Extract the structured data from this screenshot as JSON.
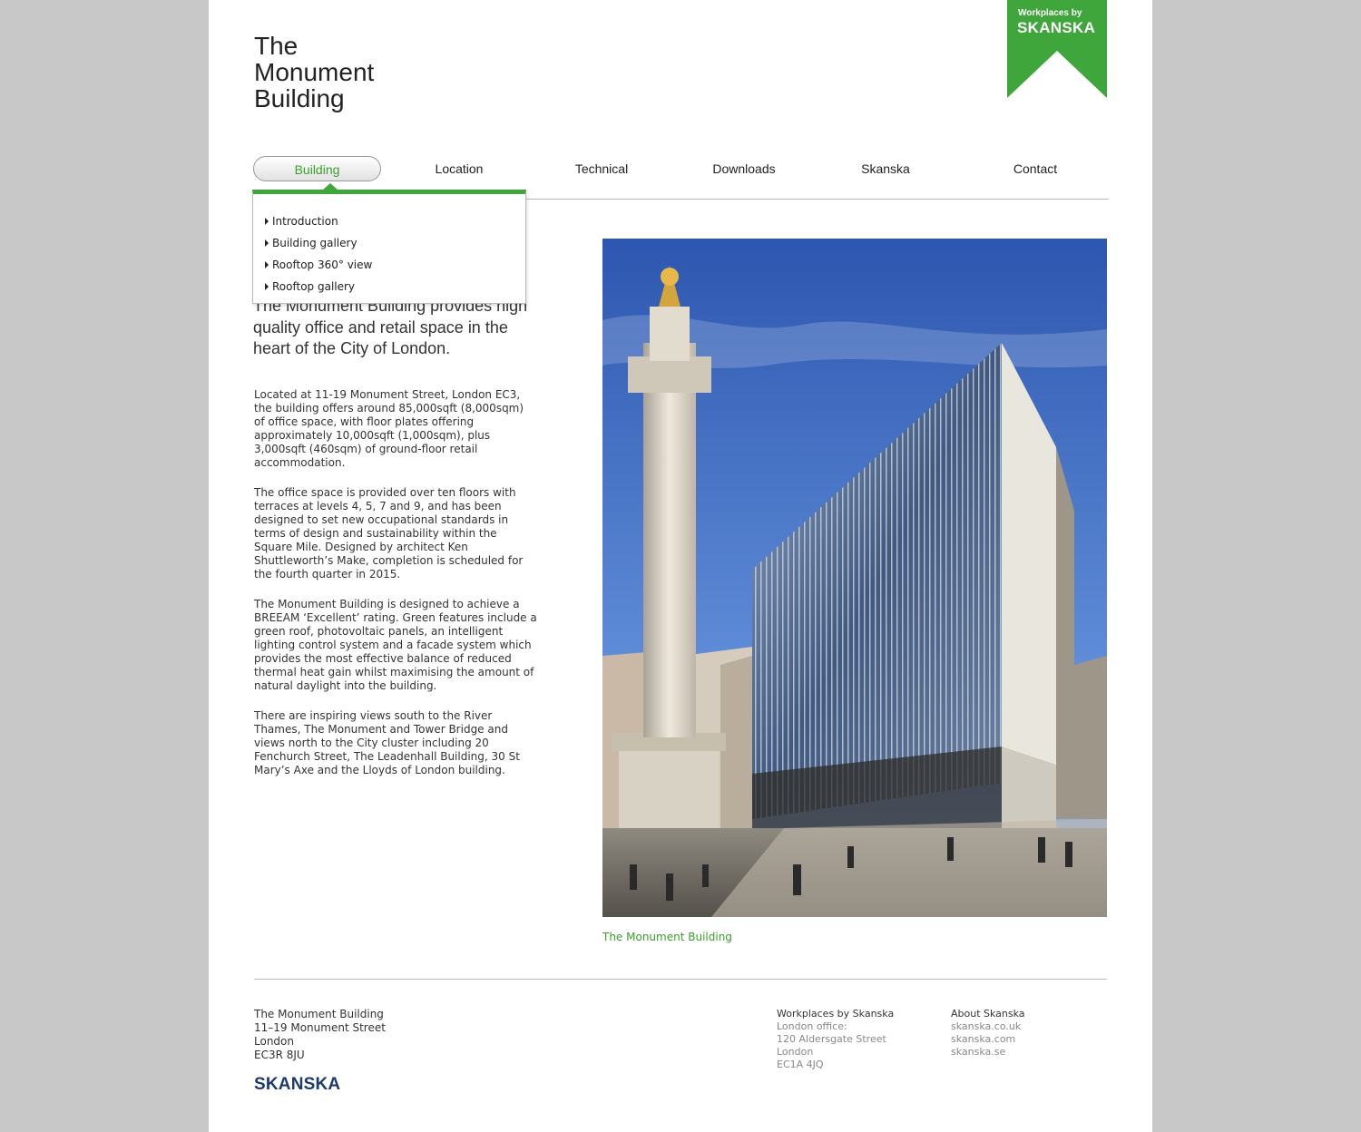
{
  "site": {
    "title_lines": [
      "The",
      "Monument",
      "Building"
    ]
  },
  "badge": {
    "small": "Workplaces by",
    "big": "SKANSKA",
    "color": "#3ea63a"
  },
  "nav": {
    "items": [
      {
        "label": "Building",
        "active": true
      },
      {
        "label": "Location"
      },
      {
        "label": "Technical"
      },
      {
        "label": "Downloads"
      },
      {
        "label": "Skanska"
      },
      {
        "label": "Contact"
      }
    ]
  },
  "dropdown": {
    "items": [
      "Introduction",
      "Building gallery",
      "Rooftop 360° view",
      "Rooftop gallery"
    ]
  },
  "intro": "The Monument Building provides high quality office and retail space in the heart of the City of London.",
  "body": [
    "Located at 11-19 Monument Street, London EC3, the building offers around 85,000sqft (8,000sqm) of office space, with floor plates offering approximately 10,000sqft (1,000sqm), plus 3,000sqft (460sqm) of ground-floor retail accommodation.",
    "The office space is provided over ten floors with terraces at levels 4, 5, 7 and 9, and has been designed to set new occupational standards in terms of design and sustainability within the Square Mile. Designed by architect Ken Shuttleworth’s Make, completion is scheduled for the fourth quarter in 2015.",
    "The Monument Building is designed to achieve a BREEAM ‘Excellent’ rating. Green features include a green roof, photovoltaic panels, an intelligent lighting control system and a facade system which provides the most effective balance of reduced thermal heat gain whilst maximising the amount of natural daylight into the building.",
    "There are inspiring views south to the River Thames, The Monument and Tower Bridge and views north to the City cluster including 20 Fenchurch Street, The Leadenhall Building, 30 St Mary’s Axe and the Lloyds of London building."
  ],
  "photo": {
    "caption": "The Monument Building"
  },
  "footer": {
    "address": [
      "The Monument Building",
      "11–19 Monument Street",
      "London",
      "EC3R 8JU"
    ],
    "logo": "SKANSKA",
    "workplaces": {
      "heading": "Workplaces by Skanska",
      "lines": [
        "London office:",
        "120 Aldersgate Street",
        "London",
        "EC1A 4JQ"
      ]
    },
    "about": {
      "heading": "About Skanska",
      "links": [
        "skanska.co.uk",
        "skanska.com",
        "skanska.se"
      ]
    }
  },
  "colors": {
    "accent": "#3ea63a",
    "background": "#c8c8c8",
    "footer_logo": "#1d3a6e"
  }
}
